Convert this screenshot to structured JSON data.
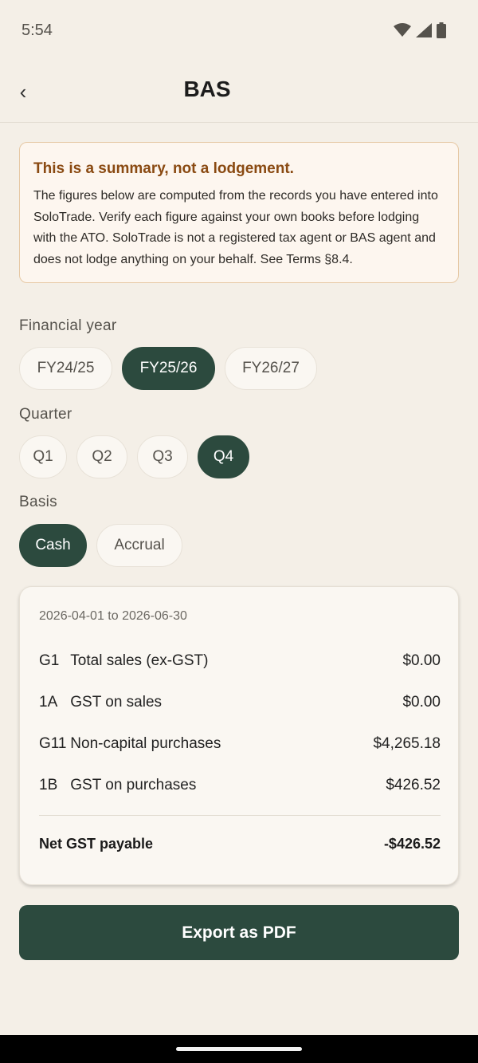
{
  "status_bar": {
    "time": "5:54",
    "icons": [
      "wifi-icon",
      "signal-icon",
      "battery-icon"
    ]
  },
  "app_bar": {
    "back_icon": "‹",
    "title": "BAS"
  },
  "disclaimer": {
    "title": "This is a summary, not a lodgement.",
    "body": "The figures below are computed from the records you have entered into SoloTrade. Verify each figure against your own books before lodging with the ATO. SoloTrade is not a registered tax agent or BAS agent and does not lodge anything on your behalf. See Terms §8.4."
  },
  "financial_year": {
    "label": "Financial year",
    "options": [
      "FY24/25",
      "FY25/26",
      "FY26/27"
    ],
    "selected": "FY25/26"
  },
  "quarter": {
    "label": "Quarter",
    "options": [
      "Q1",
      "Q2",
      "Q3",
      "Q4"
    ],
    "selected": "Q4"
  },
  "basis": {
    "label": "Basis",
    "options": [
      "Cash",
      "Accrual"
    ],
    "selected": "Cash"
  },
  "summary": {
    "period": "2026-04-01 to 2026-06-30",
    "rows": [
      {
        "code": "G1",
        "label": "Total sales (ex-GST)",
        "value": "$0.00"
      },
      {
        "code": "1A",
        "label": "GST on sales",
        "value": "$0.00"
      },
      {
        "code": "G11",
        "label": "Non-capital purchases",
        "value": "$4,265.18"
      },
      {
        "code": "1B",
        "label": "GST on purchases",
        "value": "$426.52"
      }
    ],
    "net_label": "Net GST payable",
    "net_value": "-$426.52"
  },
  "export_label": "Export as PDF",
  "colors": {
    "accent": "#2c4a3e",
    "background": "#f4efe7",
    "warning_text": "#8a4a12",
    "warning_border": "#e6c8a4"
  }
}
